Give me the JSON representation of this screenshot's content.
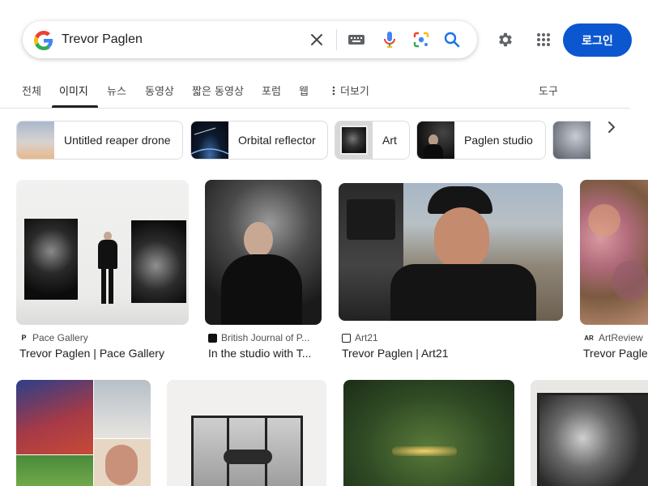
{
  "search": {
    "query": "Trevor Paglen",
    "icons": [
      "google-g-logo",
      "clear-icon",
      "keyboard-icon",
      "mic-icon",
      "lens-icon",
      "search-icon"
    ]
  },
  "header": {
    "settings_icon": "gear-icon",
    "apps_icon": "apps-grid-icon",
    "login_label": "로그인"
  },
  "tabs": [
    {
      "label": "전체"
    },
    {
      "label": "이미지",
      "active": true
    },
    {
      "label": "뉴스"
    },
    {
      "label": "동영상"
    },
    {
      "label": "짧은 동영상"
    },
    {
      "label": "포럼"
    },
    {
      "label": "웹"
    },
    {
      "label": "더보기"
    },
    {
      "label": "도구"
    }
  ],
  "chips": [
    {
      "label": "Untitled reaper drone"
    },
    {
      "label": "Orbital reflector"
    },
    {
      "label": "Art"
    },
    {
      "label": "Paglen studio"
    }
  ],
  "results": [
    {
      "source": "Pace Gallery",
      "title": "Trevor Paglen | Pace Gallery",
      "favicon": "P"
    },
    {
      "source": "British Journal of P...",
      "title": "In the studio with T...",
      "favicon": ""
    },
    {
      "source": "Art21",
      "title": "Trevor Paglen | Art21",
      "favicon": ""
    },
    {
      "source": "ArtReview",
      "title": "Trevor Pagle",
      "favicon": "AR"
    }
  ],
  "colors": {
    "accent": "#0b57d0",
    "google_blue": "#4285f4",
    "google_red": "#ea4335",
    "google_yellow": "#fbbc05",
    "google_green": "#34a853"
  }
}
